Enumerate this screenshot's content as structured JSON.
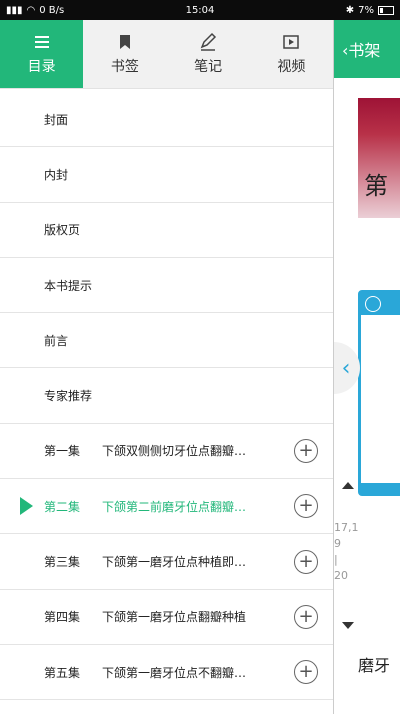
{
  "status": {
    "signal": "0 B/s",
    "time": "15:04",
    "battery": "7%"
  },
  "tabs": [
    {
      "label": "目录",
      "icon": "list-icon",
      "active": true
    },
    {
      "label": "书签",
      "icon": "bookmark-icon"
    },
    {
      "label": "笔记",
      "icon": "pen-icon"
    },
    {
      "label": "视频",
      "icon": "video-icon"
    }
  ],
  "toc": [
    {
      "title": "封面"
    },
    {
      "title": "内封"
    },
    {
      "title": "版权页"
    },
    {
      "title": "本书提示"
    },
    {
      "title": "前言"
    },
    {
      "title": "专家推荐"
    },
    {
      "ep": "第一集",
      "sub": "下颌双侧侧切牙位点翻瓣…"
    },
    {
      "ep": "第二集",
      "sub": "下颌第二前磨牙位点翻瓣…",
      "current": true
    },
    {
      "ep": "第三集",
      "sub": "下颌第一磨牙位点种植即…"
    },
    {
      "ep": "第四集",
      "sub": "下颌第一磨牙位点翻瓣种植"
    },
    {
      "ep": "第五集",
      "sub": "下颌第一磨牙位点不翻瓣…"
    }
  ],
  "right": {
    "back_label": "书架",
    "cover_text": "第",
    "nums": [
      "17,1",
      "9",
      "|",
      "20"
    ],
    "bottom_text": "磨牙"
  },
  "colors": {
    "accent": "#22b77a",
    "video": "#2aa7d8"
  }
}
